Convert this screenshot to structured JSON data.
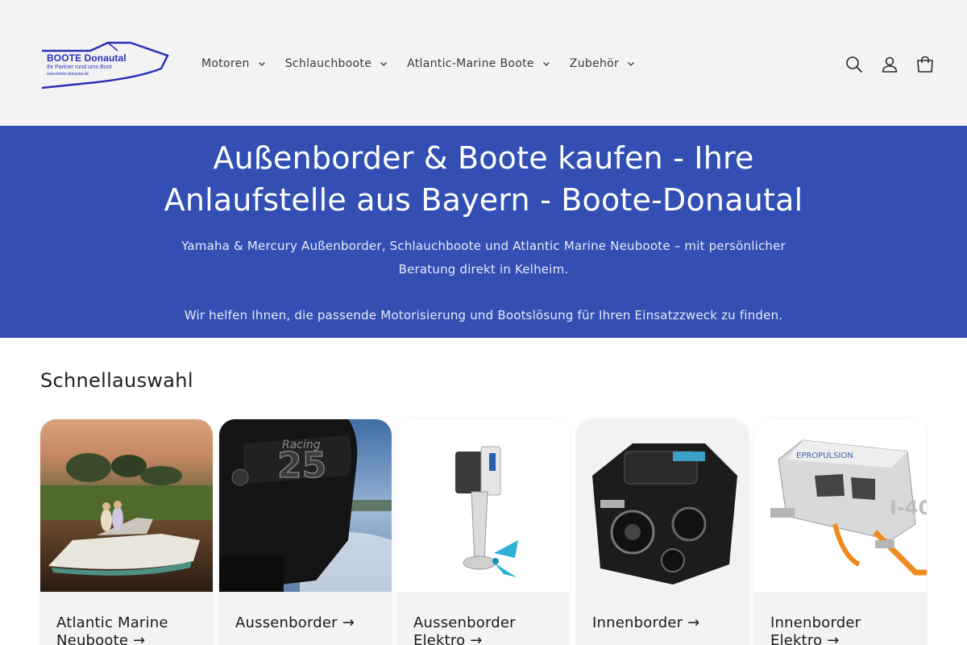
{
  "brand": {
    "logo_name": "BOOTE Donautal",
    "logo_tagline": "Ihr Partner rund ums Boot",
    "logo_url": "www.boote-donautal.de",
    "accent": "#334fb4",
    "logo_color": "#2a2fb8"
  },
  "nav": {
    "items": [
      {
        "label": "Motoren",
        "icon": "chevron-down-icon"
      },
      {
        "label": "Schlauchboote",
        "icon": "chevron-down-icon"
      },
      {
        "label": "Atlantic-Marine Boote",
        "icon": "chevron-down-icon"
      },
      {
        "label": "Zubehör",
        "icon": "chevron-down-icon"
      }
    ]
  },
  "header_icons": [
    "search-icon",
    "account-icon",
    "cart-icon"
  ],
  "hero": {
    "title": "Außenborder & Boote kaufen - Ihre Anlaufstelle aus Bayern - Boote-Donautal",
    "subtitle": "Yamaha & Mercury Außenborder, Schlauchboote und Atlantic Marine Neuboote – mit persönlicher Beratung direkt in Kelheim.",
    "subtitle2": "Wir helfen Ihnen, die passende Motorisierung und Bootslösung für Ihren Einsatzzweck zu finden."
  },
  "quick": {
    "title": "Schnellauswahl",
    "cards": [
      {
        "label": "Atlantic Marine Neuboote →",
        "image": "boat-photo"
      },
      {
        "label": "Aussenborder →",
        "image": "outboard-motor-photo"
      },
      {
        "label": "Aussenborder Elektro →",
        "image": "electric-outboard-photo"
      },
      {
        "label": "Innenborder →",
        "image": "inboard-engine-photo"
      },
      {
        "label": "Innenborder Elektro →",
        "image": "electric-inboard-photo"
      }
    ]
  }
}
